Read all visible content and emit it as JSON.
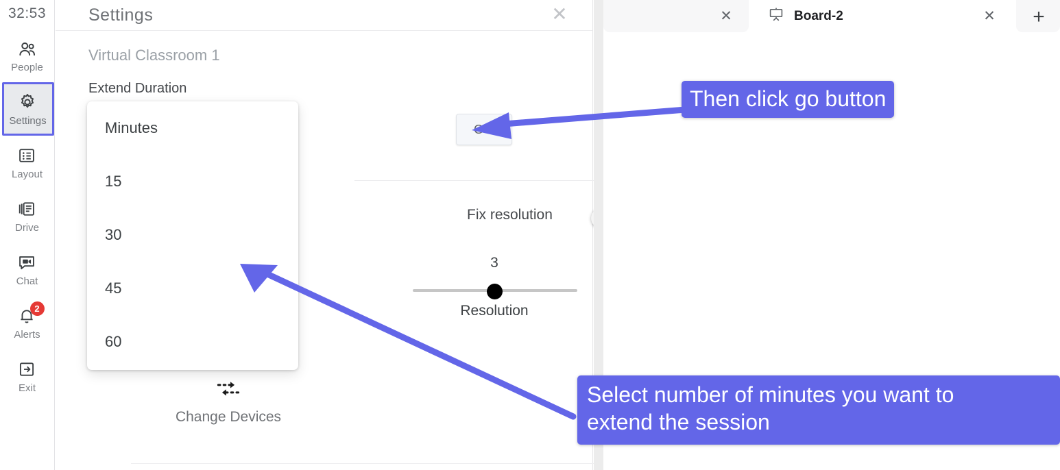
{
  "rail": {
    "timer": "32:53",
    "items": [
      {
        "label": "People",
        "icon": "people-icon",
        "active": false,
        "badge": null
      },
      {
        "label": "Settings",
        "icon": "gear-icon",
        "active": true,
        "badge": null
      },
      {
        "label": "Layout",
        "icon": "layout-icon",
        "active": false,
        "badge": null
      },
      {
        "label": "Drive",
        "icon": "drive-icon",
        "active": false,
        "badge": null
      },
      {
        "label": "Chat",
        "icon": "chat-icon",
        "active": false,
        "badge": null
      },
      {
        "label": "Alerts",
        "icon": "bell-icon",
        "active": false,
        "badge": "2"
      },
      {
        "label": "Exit",
        "icon": "exit-icon",
        "active": false,
        "badge": null
      }
    ]
  },
  "panel": {
    "title": "Settings",
    "close_icon": "close-icon",
    "room_name": "Virtual Classroom 1",
    "extend_duration_label": "Extend Duration",
    "dropdown": {
      "header": "Minutes",
      "options": [
        "15",
        "30",
        "45",
        "60"
      ]
    },
    "go_button": "GO",
    "fix_resolution_label": "Fix resolution",
    "fix_resolution_state": "off",
    "resolution_value": "3",
    "resolution_label": "Resolution",
    "resolution_min": 1,
    "resolution_max": 5,
    "change_devices_label": "Change Devices",
    "change_devices_icon": "swap-arrows-icon"
  },
  "tabs": {
    "previous_close_icon": "close-icon",
    "active": {
      "label": "Board-2",
      "icon": "whiteboard-icon",
      "close_icon": "close-icon"
    },
    "new_tab_icon": "plus-icon"
  },
  "annotations": {
    "go_note": "Then click go button",
    "select_note": "Select number of minutes you want to\nextend the session",
    "color": "#6366e8"
  }
}
